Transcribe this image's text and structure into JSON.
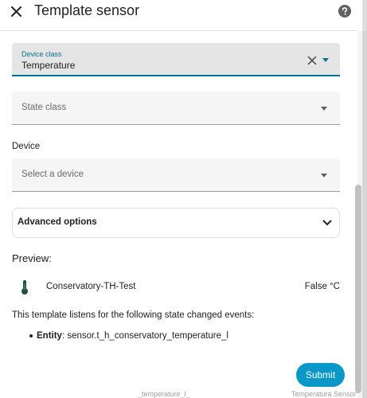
{
  "dialog": {
    "title": "Template sensor",
    "close_icon": "close-icon",
    "help_icon": "help-circle-icon"
  },
  "fields": {
    "device_class": {
      "label": "Device class",
      "value": "Temperature"
    },
    "state_class": {
      "placeholder": "State class"
    },
    "device_section_label": "Device",
    "device": {
      "placeholder": "Select a device"
    }
  },
  "advanced": {
    "label": "Advanced options",
    "icon": "chevron-down-icon"
  },
  "preview": {
    "title": "Preview:",
    "icon": "thermometer-icon",
    "entity_name": "Conservatory-TH-Test",
    "state": "False °C",
    "listens_text": "This template listens for the following state changed events:",
    "entity_label": "Entity",
    "entity_id": ": sensor.t_h_conservatory_temperature_l"
  },
  "actions": {
    "submit_label": "Submit"
  },
  "colors": {
    "accent": "#03758f",
    "submit_bg": "#0a98c9",
    "thermometer": "#1f4e3d"
  },
  "background_peek": [
    "_temperature_l_",
    "Temperatura Sensor"
  ]
}
